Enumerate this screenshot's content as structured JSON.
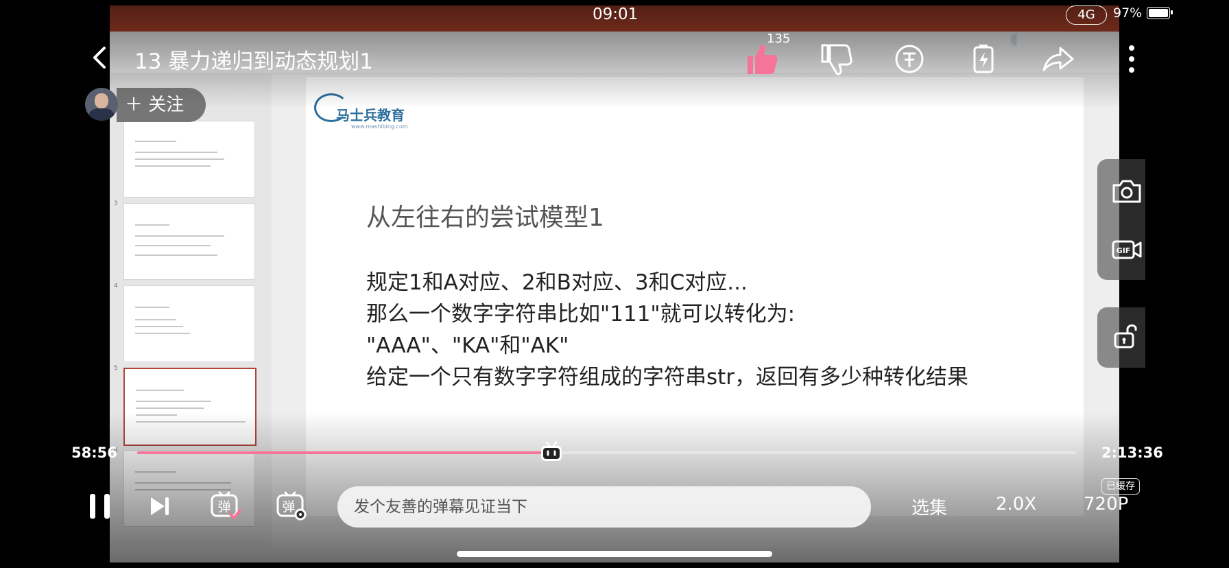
{
  "status_bar": {
    "time": "09:01",
    "network": "4G",
    "battery": "97%"
  },
  "header": {
    "title": "13 暴力递归到动态规划1",
    "like_count": "135"
  },
  "uploader": {
    "follow_label": "＋ 关注"
  },
  "slide": {
    "logo_text": "马士兵教育",
    "logo_url": "www.mashibing.com",
    "title": "从左往右的尝试模型1",
    "lines": [
      "规定1和A对应、2和B对应、3和C对应...",
      "那么一个数字字符串比如\"111\"就可以转化为:",
      "\"AAA\"、\"KA\"和\"AK\"",
      "给定一个只有数字字符组成的字符串str，返回有多少种转化结果"
    ]
  },
  "player": {
    "current_time": "58:56",
    "total_time": "2:13:36",
    "progress": 0.441,
    "danmaku_placeholder": "发个友善的弹幕见证当下",
    "episodes_label": "选集",
    "speed_label": "2.0X",
    "quality_label": "720P",
    "cached_label": "已缓存",
    "danmaku_icon_label": "弹"
  },
  "colors": {
    "accent": "#f67499",
    "like": "#f67499"
  }
}
